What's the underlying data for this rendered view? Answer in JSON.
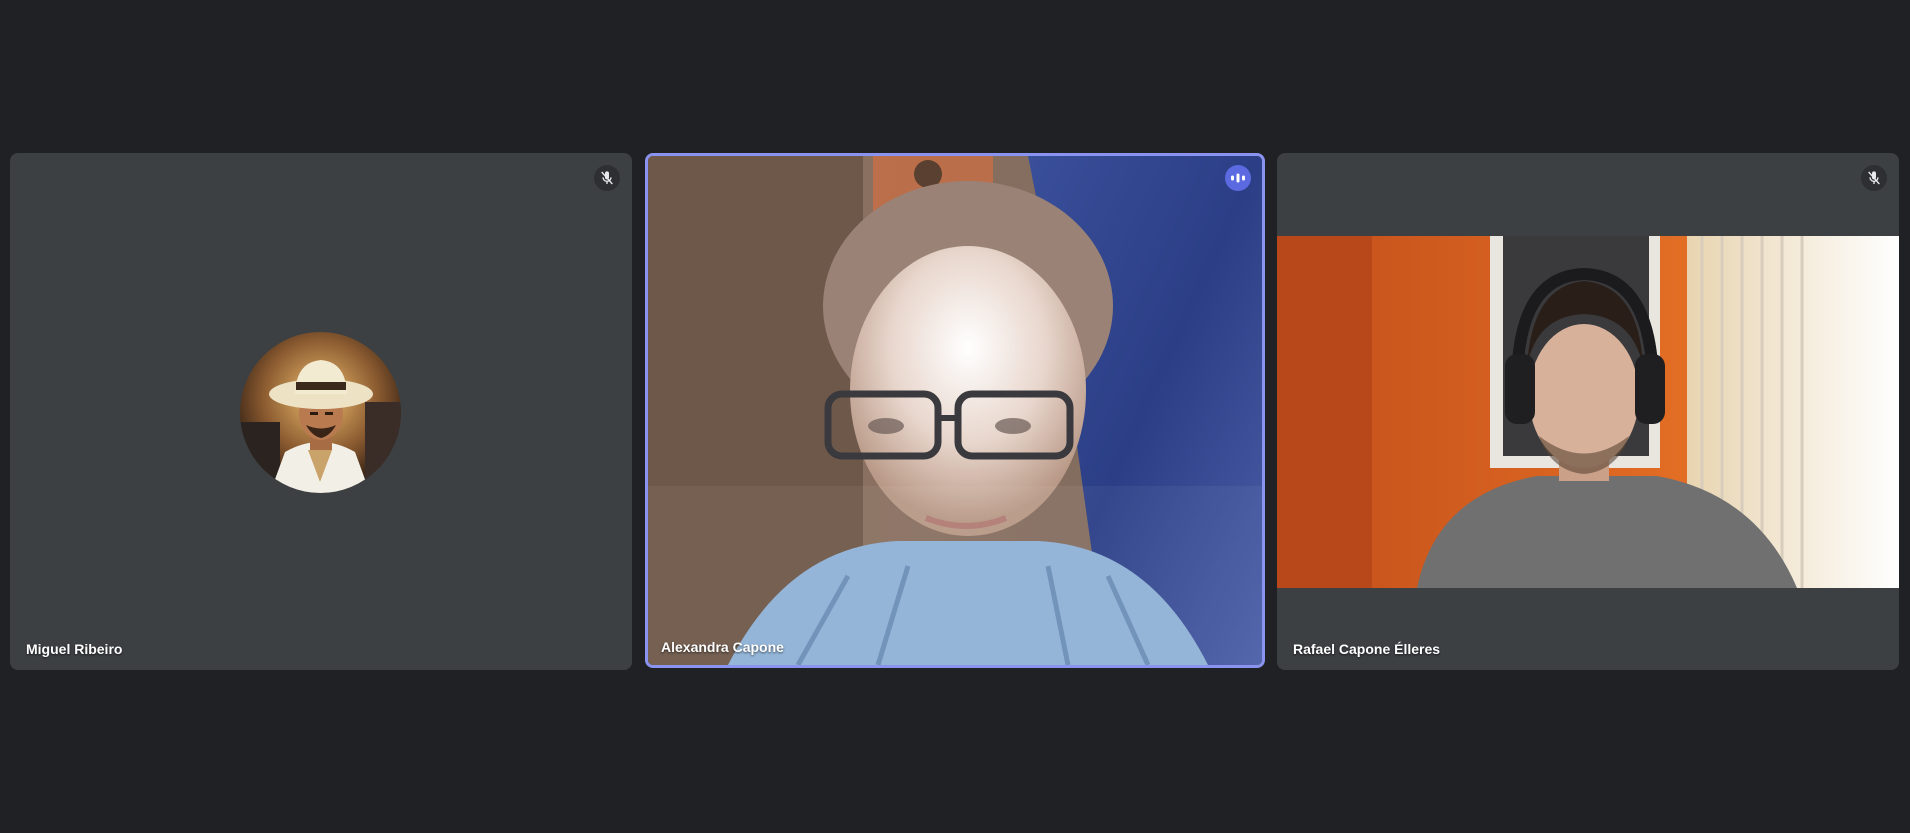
{
  "participants": [
    {
      "name": "Miguel Ribeiro",
      "status_icon": "mic-off-icon",
      "media": "avatar"
    },
    {
      "name": "Alexandra Capone",
      "status_icon": "speaking-indicator-icon",
      "media": "video",
      "active_speaker": true
    },
    {
      "name": "Rafael Capone Élleres",
      "status_icon": "mic-off-icon",
      "media": "video"
    }
  ],
  "colors": {
    "background": "#202124",
    "tile": "#3c4043",
    "active_border": "#8a94f0",
    "speaking_badge": "#5b6ae0"
  }
}
